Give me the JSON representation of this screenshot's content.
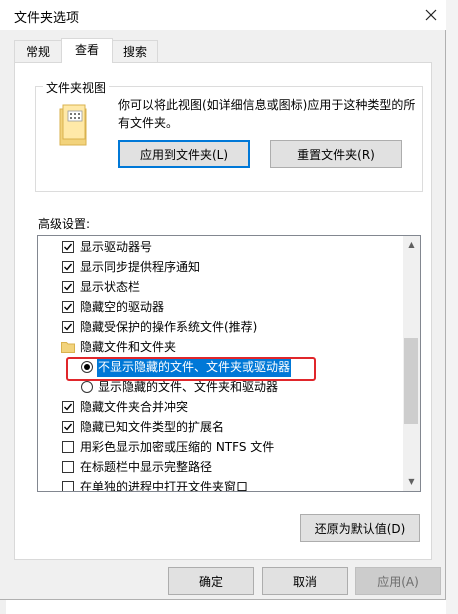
{
  "window": {
    "title": "文件夹选项"
  },
  "tabs": [
    {
      "label": "常规"
    },
    {
      "label": "查看"
    },
    {
      "label": "搜索"
    }
  ],
  "folder_views": {
    "legend": "文件夹视图",
    "description": "你可以将此视图(如详细信息或图标)应用于这种类型的所有文件夹。",
    "apply_button": "应用到文件夹(L)",
    "reset_button": "重置文件夹(R)"
  },
  "advanced": {
    "label": "高级设置:",
    "items": [
      {
        "type": "checkbox",
        "checked": true,
        "label": "显示驱动器号"
      },
      {
        "type": "checkbox",
        "checked": true,
        "label": "显示同步提供程序通知"
      },
      {
        "type": "checkbox",
        "checked": true,
        "label": "显示状态栏"
      },
      {
        "type": "checkbox",
        "checked": true,
        "label": "隐藏空的驱动器"
      },
      {
        "type": "checkbox",
        "checked": true,
        "label": "隐藏受保护的操作系统文件(推荐)"
      },
      {
        "type": "folder",
        "label": "隐藏文件和文件夹"
      },
      {
        "type": "radio",
        "checked": true,
        "label": "不显示隐藏的文件、文件夹或驱动器"
      },
      {
        "type": "radio",
        "checked": false,
        "label": "显示隐藏的文件、文件夹和驱动器"
      },
      {
        "type": "checkbox",
        "checked": true,
        "label": "隐藏文件夹合并冲突"
      },
      {
        "type": "checkbox",
        "checked": true,
        "label": "隐藏已知文件类型的扩展名"
      },
      {
        "type": "checkbox",
        "checked": false,
        "label": "用彩色显示加密或压缩的 NTFS 文件"
      },
      {
        "type": "checkbox",
        "checked": false,
        "label": "在标题栏中显示完整路径"
      },
      {
        "type": "checkbox",
        "checked": false,
        "label": "在单独的进程中打开文件夹窗口"
      }
    ],
    "restore_button": "还原为默认值(D)"
  },
  "footer": {
    "ok": "确定",
    "cancel": "取消",
    "apply": "应用(A)"
  },
  "colors": {
    "selection": "#0078d7",
    "annotation_box": "#e0262b"
  }
}
